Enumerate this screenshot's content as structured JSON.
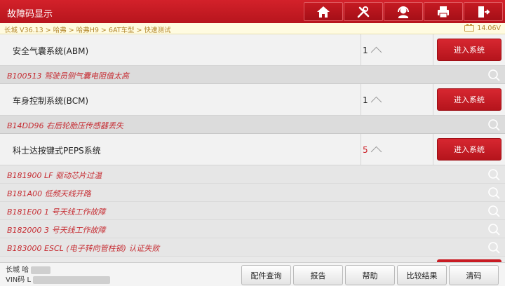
{
  "header": {
    "title": "故障码显示",
    "buttons": [
      {
        "name": "home-button",
        "icon": "home-icon"
      },
      {
        "name": "diagnose-tools-button",
        "icon": "wrench-screwdriver-icon"
      },
      {
        "name": "support-button",
        "icon": "headset-icon"
      },
      {
        "name": "print-button",
        "icon": "printer-icon"
      },
      {
        "name": "exit-button",
        "icon": "exit-icon"
      }
    ]
  },
  "breadcrumb": {
    "path": "长城 V36.13 > 哈弗 > 哈弗H9 > 6AT车型 > 快速测试",
    "voltage": "14.06V"
  },
  "systems": [
    {
      "name": "安全气囊系统(ABM)",
      "count": "1",
      "button": "进入系统",
      "faults": [
        {
          "code": "B100513",
          "desc": "驾驶员侧气囊电阻值太高"
        }
      ]
    },
    {
      "name": "车身控制系统(BCM)",
      "count": "1",
      "button": "进入系统",
      "faults": [
        {
          "code": "B14DD96",
          "desc": "右后轮胎压传感器丢失"
        }
      ]
    },
    {
      "name": "科士达按键式PEPS系统",
      "count": "5",
      "button": "进入系统",
      "faults": [
        {
          "code": "B181900",
          "desc": "LF 驱动芯片过温"
        },
        {
          "code": "B181A00",
          "desc": "低频天线开路"
        },
        {
          "code": "B181E00",
          "desc": "1 号天线工作故障"
        },
        {
          "code": "B182000",
          "desc": "3 号天线工作故障"
        },
        {
          "code": "B183000",
          "desc": "ESCL (电子转向管柱锁) 认证失败"
        }
      ]
    }
  ],
  "footer": {
    "vehicle_line1": "长城 哈",
    "vehicle_line2": "VIN码 L",
    "buttons": [
      "配件查询",
      "报告",
      "帮助",
      "比较结果",
      "清码"
    ]
  },
  "colors": {
    "accent": "#c81b23",
    "fault_text": "#c62d33",
    "breadcrumb_text": "#b3872c"
  }
}
